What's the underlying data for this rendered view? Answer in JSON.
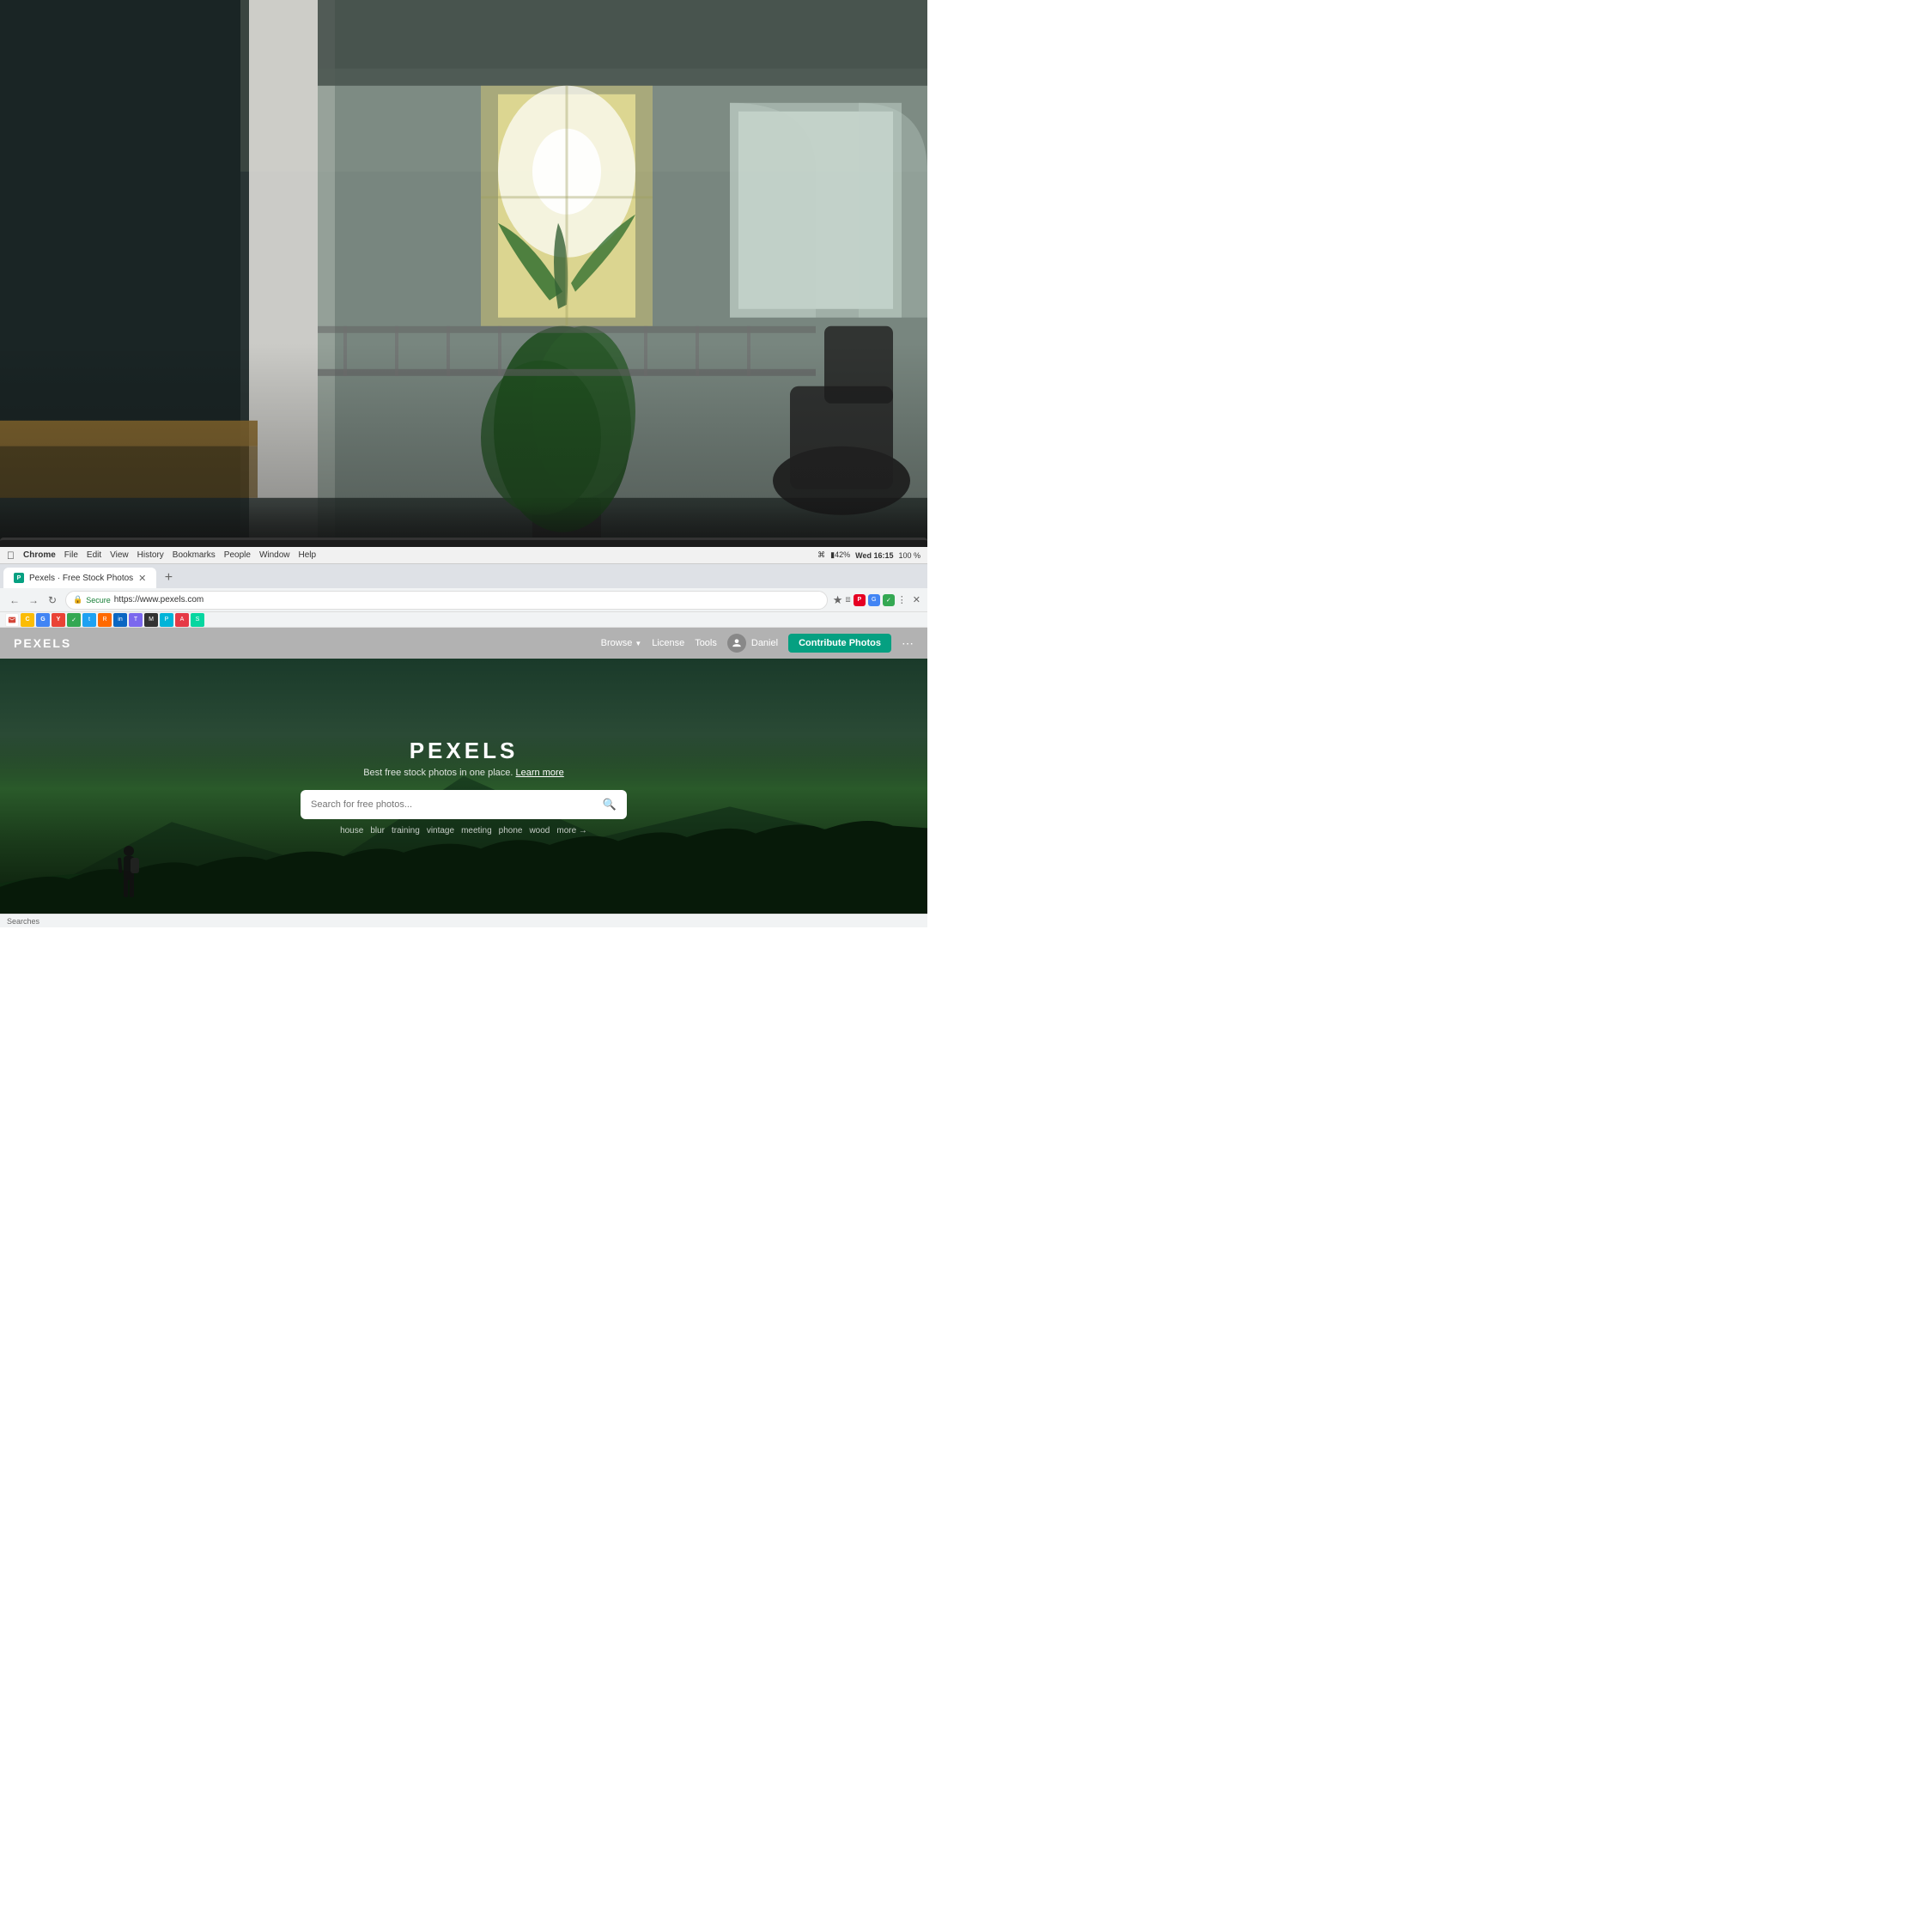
{
  "background": {
    "description": "Office space with blurred background, green plants, windows with light"
  },
  "os_menubar": {
    "menu_items": [
      "Chrome",
      "File",
      "Edit",
      "View",
      "History",
      "Bookmarks",
      "People",
      "Window",
      "Help"
    ],
    "right_items": [
      "100 %",
      "Wed 16:15"
    ]
  },
  "browser": {
    "tab": {
      "label": "Pexels · Free Stock Photos"
    },
    "url": {
      "secure_label": "Secure",
      "address": "https://www.pexels.com"
    }
  },
  "pexels": {
    "nav": {
      "logo": "PEXELS",
      "browse_label": "Browse",
      "license_label": "License",
      "tools_label": "Tools",
      "user_name": "Daniel",
      "contribute_label": "Contribute Photos"
    },
    "hero": {
      "title": "PEXELS",
      "subtitle": "Best free stock photos in one place.",
      "subtitle_link": "Learn more",
      "search_placeholder": "Search for free photos...",
      "suggestions": [
        "house",
        "blur",
        "training",
        "vintage",
        "meeting",
        "phone",
        "wood",
        "more →"
      ]
    }
  },
  "status_bar": {
    "text": "Searches"
  }
}
